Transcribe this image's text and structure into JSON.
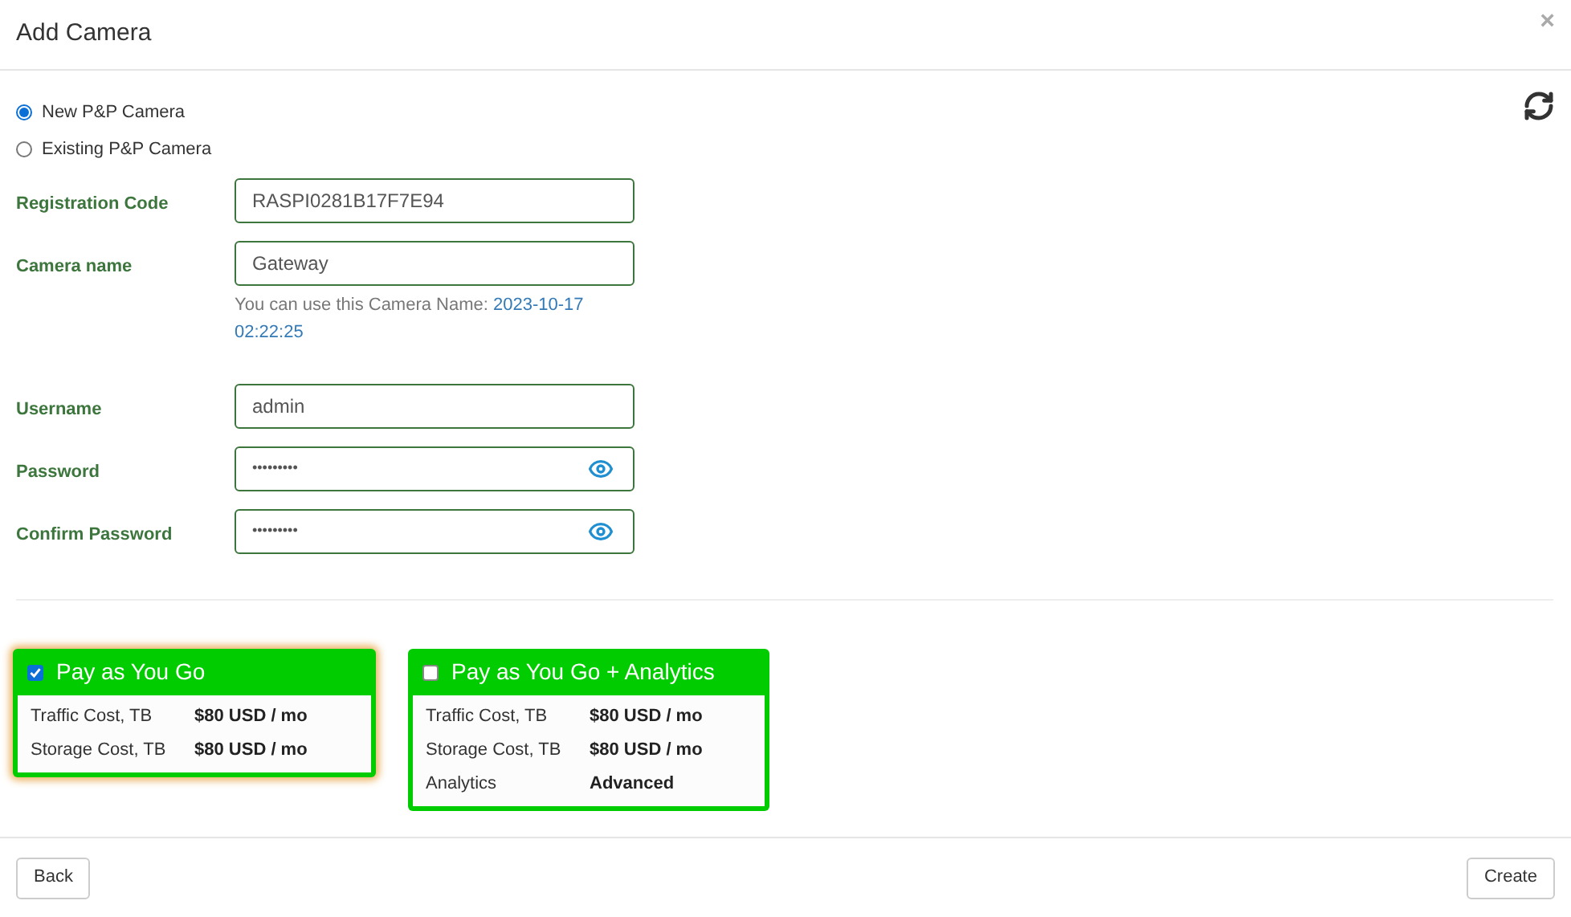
{
  "dialog": {
    "title": "Add Camera",
    "close": "×"
  },
  "camera_type": [
    {
      "label": "New P&P Camera",
      "selected": true
    },
    {
      "label": "Existing P&P Camera",
      "selected": false
    }
  ],
  "fields": [
    {
      "kind": "text",
      "label": "Registration Code",
      "value": "RASPI0281B17F7E94"
    },
    {
      "kind": "text",
      "label": "Camera name",
      "value": "Gateway",
      "hint": "You can use this Camera Name:",
      "hint_value": "2023-10-17 02:22:25"
    },
    {
      "kind": "text",
      "label": "Username",
      "value": "admin"
    },
    {
      "kind": "password",
      "label": "Password",
      "value": "•••••••••"
    },
    {
      "kind": "password",
      "label": "Confirm Password",
      "value": "•••••••••"
    }
  ],
  "plans": [
    {
      "title": "Pay as You Go",
      "selected": true,
      "rows": [
        {
          "label": "Traffic Cost, TB",
          "value": "$80 USD / mo"
        },
        {
          "label": "Storage Cost, TB",
          "value": "$80 USD / mo"
        }
      ]
    },
    {
      "title": "Pay as You Go + Analytics",
      "selected": false,
      "rows": [
        {
          "label": "Traffic Cost, TB",
          "value": "$80 USD / mo"
        },
        {
          "label": "Storage Cost, TB",
          "value": "$80 USD / mo"
        },
        {
          "label": "Analytics",
          "value": "Advanced"
        }
      ]
    }
  ],
  "buttons": {
    "back": "Back",
    "create": "Create"
  }
}
